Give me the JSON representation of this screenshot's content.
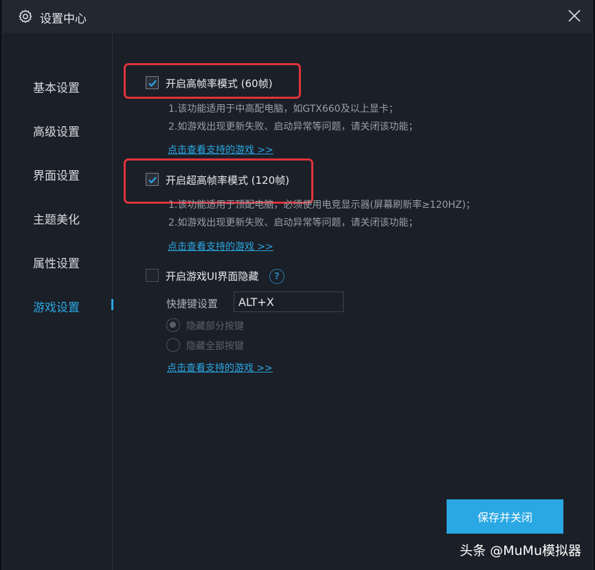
{
  "window": {
    "title": "设置中心"
  },
  "sidebar": {
    "items": [
      {
        "label": "基本设置"
      },
      {
        "label": "高级设置"
      },
      {
        "label": "界面设置"
      },
      {
        "label": "主题美化"
      },
      {
        "label": "属性设置"
      },
      {
        "label": "游戏设置",
        "active": true
      }
    ]
  },
  "options": {
    "high_fps": {
      "label": "开启高帧率模式 (60帧)",
      "checked": true,
      "desc1": "1.该功能适用于中高配电脑，如GTX660及以上显卡；",
      "desc2": "2.如游戏出现更新失败、启动异常等问题，请关闭该功能；",
      "link": "点击查看支持的游戏 >>"
    },
    "ultra_fps": {
      "label": "开启超高帧率模式 (120帧)",
      "checked": true,
      "desc1": "1.该功能适用于顶配电脑，必须使用电竞显示器(屏幕刷新率≥120HZ)；",
      "desc2": "2.如游戏出现更新失败、启动异常等问题，请关闭该功能；",
      "link": "点击查看支持的游戏 >>"
    },
    "ui_hide": {
      "label": "开启游戏UI界面隐藏",
      "checked": false,
      "help": "?",
      "hotkey_label": "快捷键设置",
      "hotkey_value": "ALT+X",
      "radio1": "隐藏部分按键",
      "radio2": "隐藏全部按键",
      "link": "点击查看支持的游戏 >>"
    }
  },
  "footer": {
    "save_label": "保存并关闭"
  },
  "watermark": "头条 @MuMu模拟器",
  "colors": {
    "accent": "#2aa8e4",
    "highlight": "#e0333b",
    "background": "#1b1f27"
  }
}
